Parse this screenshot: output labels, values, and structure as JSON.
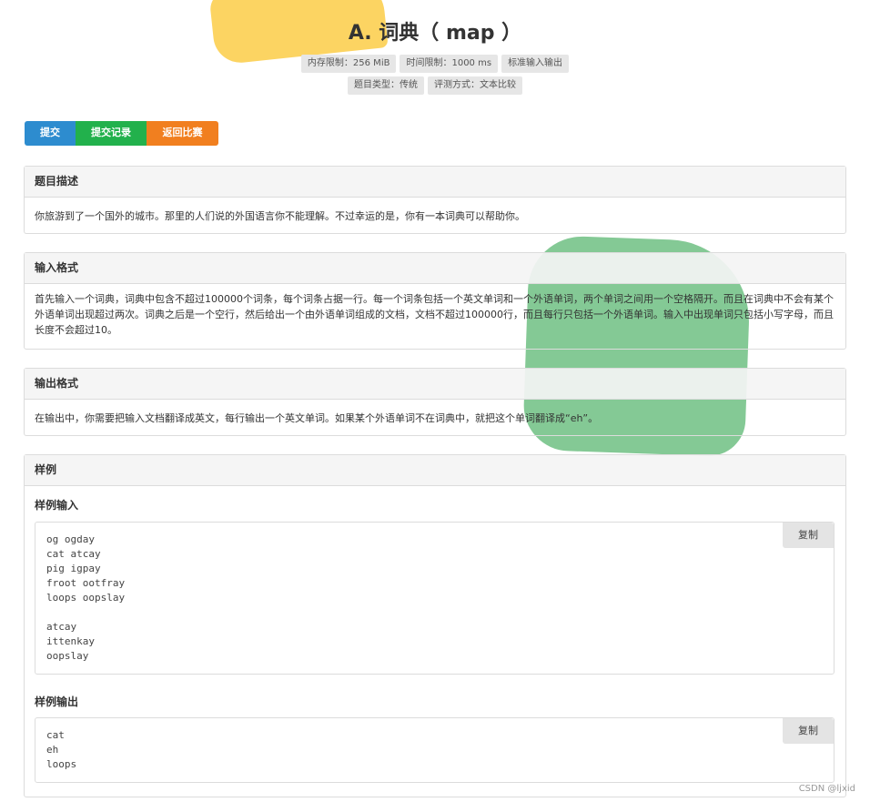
{
  "problem": {
    "title": "A. 词典（ map ）",
    "tags_row1": [
      "内存限制：256 MiB",
      "时间限制：1000 ms",
      "标准输入输出"
    ],
    "tags_row2": [
      "题目类型：传统",
      "评测方式：文本比较"
    ]
  },
  "actions": {
    "submit": "提交",
    "records": "提交记录",
    "back": "返回比赛",
    "colors": {
      "submit": "#2d8ccf",
      "records": "#22b14c",
      "back": "#f17f1f"
    }
  },
  "sections": {
    "description": {
      "heading": "题目描述",
      "text": "你旅游到了一个国外的城市。那里的人们说的外国语言你不能理解。不过幸运的是，你有一本词典可以帮助你。"
    },
    "input_format": {
      "heading": "输入格式",
      "text": "首先输入一个词典，词典中包含不超过100000个词条，每个词条占据一行。每一个词条包括一个英文单词和一个外语单词，两个单词之间用一个空格隔开。而且在词典中不会有某个外语单词出现超过两次。词典之后是一个空行，然后给出一个由外语单词组成的文档，文档不超过100000行，而且每行只包括一个外语单词。输入中出现单词只包括小写字母，而且长度不会超过10。"
    },
    "output_format": {
      "heading": "输出格式",
      "text": "在输出中，你需要把输入文档翻译成英文，每行输出一个英文单词。如果某个外语单词不在词典中，就把这个单词翻译成“eh”。"
    },
    "sample": {
      "heading": "样例",
      "input_label": "样例输入",
      "input_code": "og ogday\ncat atcay\npig igpay\nfroot ootfray\nloops oopslay\n\natcay\nittenkay\noopslay",
      "output_label": "样例输出",
      "output_code": "cat\neh\nloops",
      "copy_label": "复制"
    }
  },
  "watermark": "CSDN @ljxid"
}
